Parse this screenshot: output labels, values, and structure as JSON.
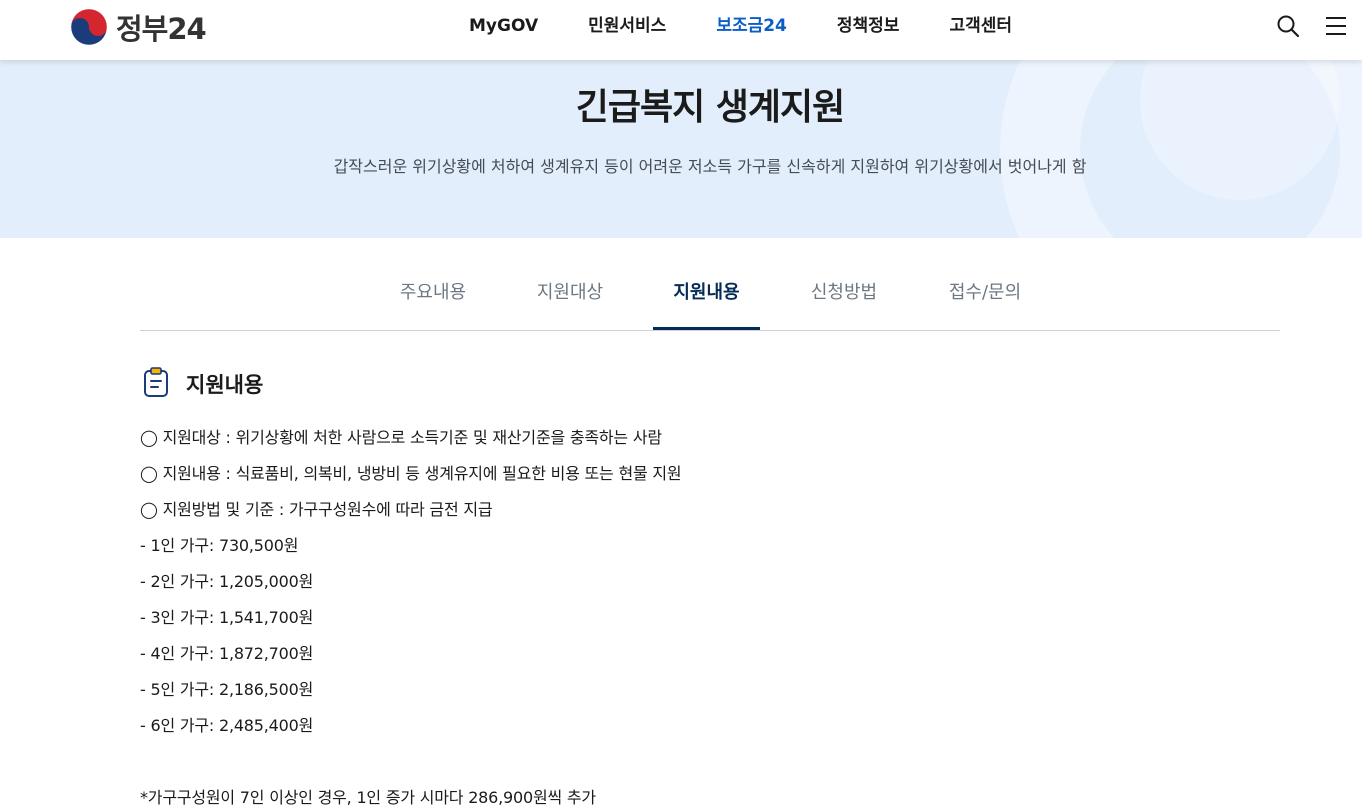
{
  "header": {
    "logo_text": "정부24",
    "nav": [
      {
        "label": "MyGOV",
        "active": false
      },
      {
        "label": "민원서비스",
        "active": false
      },
      {
        "label": "보조금24",
        "active": true
      },
      {
        "label": "정책정보",
        "active": false
      },
      {
        "label": "고객센터",
        "active": false
      }
    ],
    "icons": [
      "search-icon",
      "menu-icon"
    ]
  },
  "hero": {
    "title": "긴급복지 생계지원",
    "description": "갑작스러운 위기상황에 처하여 생계유지 등이 어려운 저소득 가구를 신속하게 지원하여 위기상황에서 벗어나게 함"
  },
  "tabs": [
    {
      "label": "주요내용",
      "active": false
    },
    {
      "label": "지원대상",
      "active": false
    },
    {
      "label": "지원내용",
      "active": true
    },
    {
      "label": "신청방법",
      "active": false
    },
    {
      "label": "접수/문의",
      "active": false
    }
  ],
  "section": {
    "icon": "clipboard-icon",
    "title": "지원내용",
    "lines": [
      "◯ 지원대상 : 위기상황에 처한 사람으로 소득기준 및 재산기준을 충족하는 사람",
      "◯ 지원내용 : 식료품비, 의복비, 냉방비 등 생계유지에 필요한 비용 또는 현물 지원",
      "◯ 지원방법 및 기준 : 가구구성원수에 따라 금전 지급",
      "- 1인 가구: 730,500원",
      "- 2인 가구: 1,205,000원",
      "- 3인 가구: 1,541,700원",
      "- 4인 가구: 1,872,700원",
      "- 5인 가구: 2,186,500원",
      "- 6인 가구: 2,485,400원",
      "*가구구성원이 7인 이상인 경우, 1인 증가 시마다 286,900원씩 추가"
    ]
  },
  "colors": {
    "accent": "#0b5ec8",
    "tab_active": "#052b57",
    "hero_bg": "#e3eefc"
  }
}
